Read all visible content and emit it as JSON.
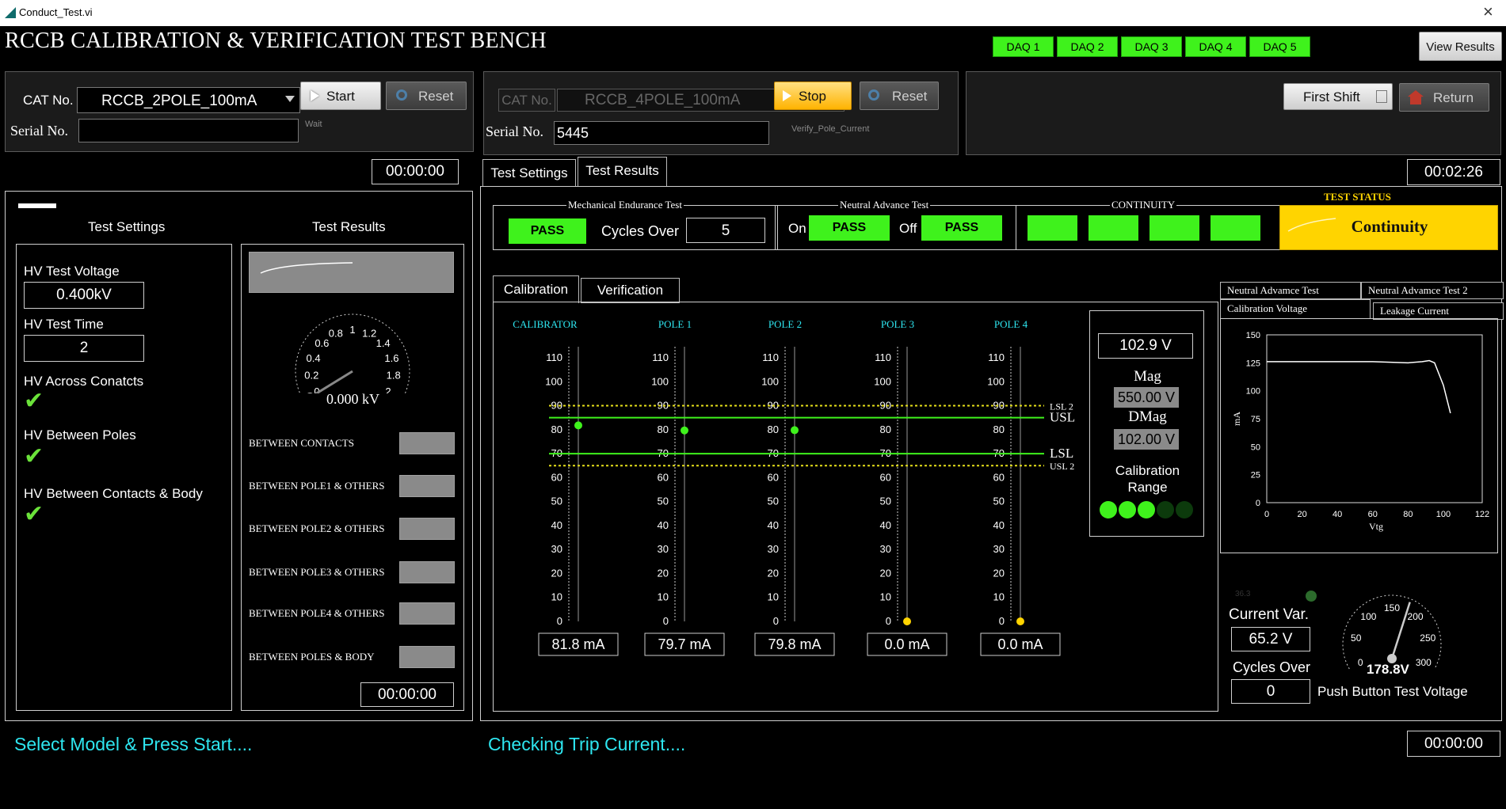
{
  "window": {
    "title": "Conduct_Test.vi",
    "close_glyph": "×"
  },
  "app_title": "RCCB CALIBRATION & VERIFICATION TEST BENCH",
  "daq": [
    "DAQ 1",
    "DAQ 2",
    "DAQ 3",
    "DAQ 4",
    "DAQ 5"
  ],
  "view_results": "View Results",
  "left_panel": {
    "cat_label": "CAT No.",
    "cat_value": "RCCB_2POLE_100mA",
    "start": "Start",
    "reset": "Reset",
    "serial_label": "Serial No.",
    "serial_value": "",
    "status_small": "Wait",
    "timer": "00:00:00"
  },
  "mid_panel": {
    "cat_label": "CAT No.",
    "cat_value": "RCCB_4POLE_100mA",
    "stop": "Stop",
    "reset": "Reset",
    "serial_label": "Serial No.",
    "serial_value": "5445",
    "status_small": "Verify_Pole_Current",
    "timer": "00:02:26"
  },
  "right_panel": {
    "shift": "First Shift",
    "return": "Return"
  },
  "hv": {
    "settings_title": "Test Settings",
    "results_title": "Test Results",
    "voltage_label": "HV Test Voltage",
    "voltage_value": "0.400kV",
    "time_label": "HV Test Time",
    "time_value": "2",
    "across_label": "HV Across Conatcts",
    "between_poles_label": "HV Between Poles",
    "contacts_body_label": "HV Between Contacts & Body",
    "gauge_ticks": [
      "0",
      "0.2",
      "0.4",
      "0.6",
      "0.8",
      "1",
      "1.2",
      "1.4",
      "1.6",
      "1.8",
      "2"
    ],
    "gauge_value": "0.000 kV",
    "gauge_reading": 0,
    "results": [
      "BETWEEN CONTACTS",
      "BETWEEN POLE1 & OTHERS",
      "BETWEEN POLE2 & OTHERS",
      "BETWEEN POLE3 & OTHERS",
      "BETWEEN POLE4 & OTHERS",
      "BETWEEN POLES & BODY"
    ],
    "timer": "00:00:00"
  },
  "main_tabs": [
    "Test Settings",
    "Test Results"
  ],
  "mech": {
    "title": "Mechanical Endurance Test",
    "status": "PASS",
    "cycles_label": "Cycles Over",
    "cycles_value": "5"
  },
  "neutral": {
    "title": "Neutral Advance Test",
    "on_label": "On",
    "on_status": "PASS",
    "off_label": "Off",
    "off_status": "PASS"
  },
  "continuity": {
    "title": "CONTINUITY"
  },
  "test_status": {
    "title": "TEST STATUS",
    "value": "Continuity"
  },
  "cal_tabs": [
    "Calibration",
    "Verification"
  ],
  "calibration": {
    "columns": [
      "CALIBRATOR",
      "POLE 1",
      "POLE 2",
      "POLE 3",
      "POLE 4"
    ],
    "readings": [
      "81.8 mA",
      "79.7 mA",
      "79.8 mA",
      "0.0 mA",
      "0.0 mA"
    ],
    "values": [
      81.8,
      79.7,
      79.8,
      0.0,
      0.0
    ],
    "ticks": [
      "110",
      "100",
      "90",
      "80",
      "70",
      "60",
      "50",
      "40",
      "30",
      "20",
      "10",
      "0"
    ],
    "limits": {
      "lsl2": "LSL 2",
      "usl": "USL",
      "lsl": "LSL",
      "usl2": "USL 2"
    },
    "limit_values": {
      "lsl2": 90,
      "usl": 85,
      "lsl": 70,
      "usl2": 65
    }
  },
  "voltage_panel": {
    "voltage": "102.9 V",
    "mag_label": "Mag",
    "mag_value": "550.00 V",
    "dmag_label": "DMag",
    "dmag_value": "102.00 V",
    "range_label_1": "Calibration",
    "range_label_2": "Range"
  },
  "right_tabs": [
    "Neutral Advamce Test",
    "Neutral Advamce Test 2",
    "Calibration Voltage",
    "Leakage Current"
  ],
  "chart_data": {
    "type": "line",
    "xlabel": "Vtg",
    "ylabel": "mA",
    "xlim": [
      0,
      122
    ],
    "ylim": [
      0,
      150
    ],
    "xticks": [
      "0",
      "20",
      "40",
      "60",
      "80",
      "100",
      "122"
    ],
    "yticks": [
      "150",
      "125",
      "100",
      "75",
      "50",
      "25",
      "0"
    ],
    "series": [
      {
        "x": [
          0,
          20,
          40,
          60,
          70,
          80,
          88,
          92,
          95,
          100,
          104
        ],
        "y": [
          126,
          126,
          126,
          126,
          125.5,
          125,
          126,
          127,
          125,
          105,
          80
        ]
      }
    ],
    "grid": false
  },
  "push_button": {
    "faint_value": "36.3",
    "current_var_label": "Current Var.",
    "current_var_value": "65.2 V",
    "cycles_label": "Cycles Over",
    "cycles_value": "0",
    "gauge_ticks": [
      "0",
      "50",
      "100",
      "150",
      "200",
      "250",
      "300"
    ],
    "gauge_value": "178.8V",
    "gauge_reading": 178.8,
    "label": "Push Button Test Voltage"
  },
  "status_left": "Select Model & Press Start....",
  "status_mid": "Checking Trip Current....",
  "bottom_timer": "00:00:00",
  "colors": {
    "green": "#3ff21c",
    "cyan": "#2ee6f0",
    "yellow": "#ffd400"
  }
}
